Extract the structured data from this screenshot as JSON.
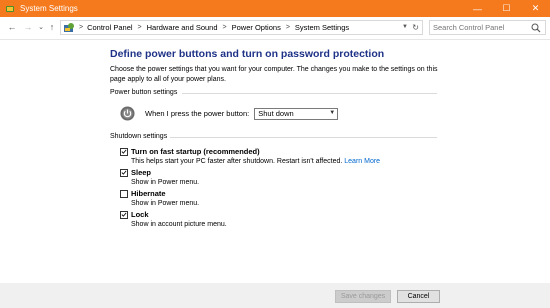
{
  "window": {
    "title": "System Settings",
    "minimize": "—",
    "maximize": "☐",
    "close": "✕"
  },
  "nav": {
    "back": "←",
    "forward": "→",
    "recent": "⌄",
    "up": "↑"
  },
  "breadcrumb": {
    "items": [
      "Control Panel",
      "Hardware and Sound",
      "Power Options",
      "System Settings"
    ],
    "separator": ">"
  },
  "search": {
    "placeholder": "Search Control Panel"
  },
  "main": {
    "heading": "Define power buttons and turn on password protection",
    "intro": "Choose the power settings that you want for your computer. The changes you make to the settings on this page apply to all of your power plans."
  },
  "power_button_settings": {
    "group_label": "Power button settings",
    "label": "When I press the power button:",
    "selected": "Shut down"
  },
  "shutdown_settings": {
    "group_label": "Shutdown settings",
    "items": [
      {
        "title": "Turn on fast startup (recommended)",
        "desc": "This helps start your PC faster after shutdown. Restart isn't affected.",
        "link": "Learn More",
        "checked": true
      },
      {
        "title": "Sleep",
        "desc": "Show in Power menu.",
        "checked": true
      },
      {
        "title": "Hibernate",
        "desc": "Show in Power menu.",
        "checked": false
      },
      {
        "title": "Lock",
        "desc": "Show in account picture menu.",
        "checked": true
      }
    ]
  },
  "footer": {
    "save": "Save changes",
    "cancel": "Cancel"
  },
  "colors": {
    "titlebar": "#f57a1e",
    "heading": "#1e3287",
    "link": "#0066cc"
  }
}
